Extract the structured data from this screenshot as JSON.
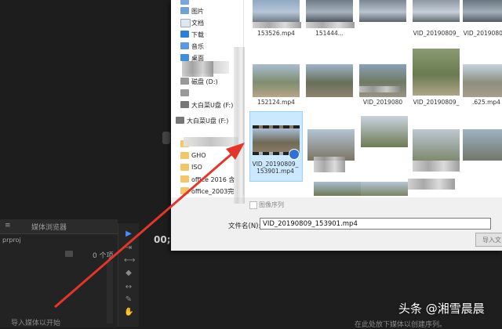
{
  "premiere": {
    "project_tab": "",
    "media_browser_tab": "媒体浏览器",
    "project_file": "prproj",
    "item_count": "0 个项",
    "timecode": "00;",
    "left_hint": "导入媒体以开始",
    "right_hint": "在此处放下媒体以创建序列。",
    "tools": [
      "selection-tool",
      "track-select-tool",
      "ripple-edit-tool",
      "razor-tool",
      "slip-tool",
      "pen-tool",
      "hand-tool",
      "type-tool"
    ]
  },
  "dialog": {
    "sidebar": [
      {
        "label": "",
        "icon": "folder-icon"
      },
      {
        "label": "图片",
        "icon": "pictures-icon"
      },
      {
        "label": "文档",
        "icon": "documents-icon"
      },
      {
        "label": "下载",
        "icon": "downloads-icon"
      },
      {
        "label": "音乐",
        "icon": "music-icon"
      },
      {
        "label": "桌面",
        "icon": "desktop-icon"
      },
      {
        "label": "磁盘 (D:)",
        "icon": "drive-icon"
      },
      {
        "label": "",
        "icon": "drive-icon"
      },
      {
        "label": "大白菜U盘 (F:)",
        "icon": "usb-drive-icon"
      },
      {
        "label": "大白菜U盘 (F:)",
        "icon": "usb-drive-icon"
      },
      {
        "label": "",
        "icon": "folder-icon"
      },
      {
        "label": "GHO",
        "icon": "folder-icon"
      },
      {
        "label": "ISO",
        "icon": "folder-icon"
      },
      {
        "label": "office 2016 含",
        "icon": "folder-icon"
      },
      {
        "label": "office_2003完",
        "icon": "folder-icon"
      }
    ],
    "files": [
      {
        "caption": "153526.mp4"
      },
      {
        "caption": "151444..."
      },
      {
        "caption": ""
      },
      {
        "caption": "VID_20190809_"
      },
      {
        "caption": "VID_20190809_"
      },
      {
        "caption": "152124.mp4"
      },
      {
        "caption": ""
      },
      {
        "caption": "VID_2019080"
      },
      {
        "caption": "VID_20190809_"
      },
      {
        "caption": ".625.mp4"
      },
      {
        "caption": "VID_20190809_\n153901.mp4"
      }
    ],
    "image_sequence_label": "图像序列",
    "filename_label": "文件名(N):",
    "filename_value": "VID_20190809_153901.mp4",
    "import_button": "导入文"
  },
  "watermark": "头条 @湘雪晨晨",
  "colors": {
    "annotation_arrow": "#e2362b",
    "selection_fill": "#cce8ff",
    "folder": "#f2c66b"
  }
}
